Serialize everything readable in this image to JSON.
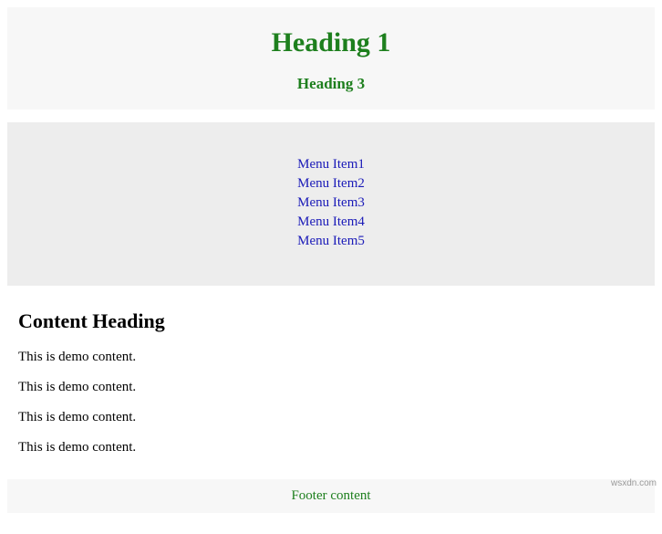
{
  "header": {
    "heading1": "Heading 1",
    "heading3": "Heading 3"
  },
  "nav": {
    "items": [
      "Menu Item1",
      "Menu Item2",
      "Menu Item3",
      "Menu Item4",
      "Menu Item5"
    ]
  },
  "content": {
    "heading": "Content Heading",
    "paragraphs": [
      "This is demo content.",
      "This is demo content.",
      "This is demo content.",
      "This is demo content."
    ]
  },
  "footer": {
    "text": "Footer content"
  },
  "watermark": "wsxdn.com"
}
